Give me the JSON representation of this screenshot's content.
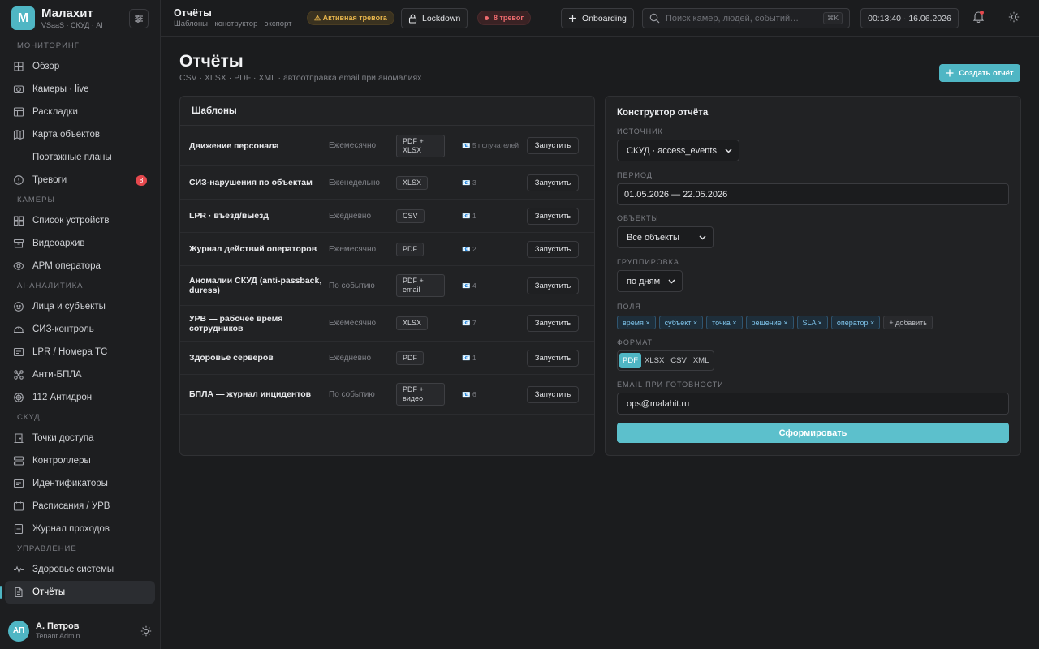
{
  "brand": {
    "logo_letter": "M",
    "name": "Малахит",
    "subtitle": "VSaaS · СКУД · AI"
  },
  "sidebar": {
    "sections": [
      {
        "title": "МОНИТОРИНГ",
        "items": [
          {
            "label": "Обзор",
            "icon": "grid-icon"
          },
          {
            "label": "Камеры · live",
            "icon": "camera-icon"
          },
          {
            "label": "Раскладки",
            "icon": "layout-icon"
          },
          {
            "label": "Карта объектов",
            "icon": "map-icon"
          },
          {
            "label": "Поэтажные планы",
            "icon": "",
            "sub": true
          },
          {
            "label": "Тревоги",
            "icon": "alert-icon",
            "badge": "8"
          }
        ]
      },
      {
        "title": "КАМЕРЫ",
        "items": [
          {
            "label": "Список устройств",
            "icon": "devices-icon"
          },
          {
            "label": "Видеоархив",
            "icon": "archive-icon"
          },
          {
            "label": "АРМ оператора",
            "icon": "eye-icon"
          }
        ]
      },
      {
        "title": "AI-АНАЛИТИКА",
        "items": [
          {
            "label": "Лица и субъекты",
            "icon": "face-icon"
          },
          {
            "label": "СИЗ-контроль",
            "icon": "helmet-icon"
          },
          {
            "label": "LPR / Номера ТС",
            "icon": "plate-icon"
          },
          {
            "label": "Анти-БПЛА",
            "icon": "drone-icon"
          },
          {
            "label": "112 Антидрон",
            "icon": "radar-icon"
          }
        ]
      },
      {
        "title": "СКУД",
        "items": [
          {
            "label": "Точки доступа",
            "icon": "door-icon"
          },
          {
            "label": "Контроллеры",
            "icon": "server-icon"
          },
          {
            "label": "Идентификаторы",
            "icon": "id-card-icon"
          },
          {
            "label": "Расписания / УРВ",
            "icon": "calendar-icon"
          },
          {
            "label": "Журнал проходов",
            "icon": "log-icon"
          }
        ]
      },
      {
        "title": "УПРАВЛЕНИЕ",
        "items": [
          {
            "label": "Здоровье системы",
            "icon": "pulse-icon"
          },
          {
            "label": "Отчёты",
            "icon": "report-icon",
            "active": true
          }
        ]
      }
    ]
  },
  "user": {
    "initials": "АП",
    "name": "А. Петров",
    "role": "Tenant Admin"
  },
  "topbar": {
    "title": "Отчёты",
    "breadcrumb": "Шаблоны · конструктор · экспорт",
    "alert_pill": "⚠ Активная тревога",
    "lockdown": "Lockdown",
    "alarms_pill": "8 тревог",
    "onboarding": "Onboarding",
    "search_placeholder": "Поиск камер, людей, событий…",
    "search_kbd": "⌘K",
    "clock": "00:13:40 · 16.06.2026"
  },
  "page": {
    "title": "Отчёты",
    "subtitle": "CSV · XLSX · PDF · XML · автоотправка email при аномалиях",
    "create_button": "Создать отчёт"
  },
  "templates": {
    "title": "Шаблоны",
    "run_label": "Запустить",
    "rows": [
      {
        "name": "Движение персонала",
        "freq": "Ежемесячно",
        "format": "PDF + XLSX",
        "recipients": "📧 5 получателей"
      },
      {
        "name": "СИЗ-нарушения по объектам",
        "freq": "Еженедельно",
        "format": "XLSX",
        "recipients": "📧 3"
      },
      {
        "name": "LPR · въезд/выезд",
        "freq": "Ежедневно",
        "format": "CSV",
        "recipients": "📧 1"
      },
      {
        "name": "Журнал действий операторов",
        "freq": "Ежемесячно",
        "format": "PDF",
        "recipients": "📧 2"
      },
      {
        "name": "Аномалии СКУД (anti-passback, duress)",
        "freq": "По событию",
        "format": "PDF + email",
        "recipients": "📧 4"
      },
      {
        "name": "УРВ — рабочее время сотрудников",
        "freq": "Ежемесячно",
        "format": "XLSX",
        "recipients": "📧 7"
      },
      {
        "name": "Здоровье серверов",
        "freq": "Ежедневно",
        "format": "PDF",
        "recipients": "📧 1"
      },
      {
        "name": "БПЛА — журнал инцидентов",
        "freq": "По событию",
        "format": "PDF + видео",
        "recipients": "📧 6"
      }
    ]
  },
  "builder": {
    "title": "Конструктор отчёта",
    "source_label": "ИСТОЧНИК",
    "source_value": "СКУД · access_events",
    "period_label": "ПЕРИОД",
    "period_value": "01.05.2026 — 22.05.2026",
    "objects_label": "ОБЪЕКТЫ",
    "objects_value": "Все объекты",
    "group_label": "ГРУППИРОВКА",
    "group_value": "по дням",
    "fields_label": "ПОЛЯ",
    "fields": [
      "время ×",
      "субъект ×",
      "точка ×",
      "решение ×",
      "SLA ×",
      "оператор ×"
    ],
    "add_field": "+ добавить",
    "format_label": "ФОРМАТ",
    "formats": [
      "PDF",
      "XLSX",
      "CSV",
      "XML"
    ],
    "format_selected": "PDF",
    "email_label": "EMAIL ПРИ ГОТОВНОСТИ",
    "email_value": "ops@malahit.ru",
    "generate_button": "Сформировать"
  },
  "colors": {
    "accent": "#4fb6c4",
    "danger": "#e5484d",
    "warning": "#e8b64c",
    "chip": "#7ec3ea"
  }
}
